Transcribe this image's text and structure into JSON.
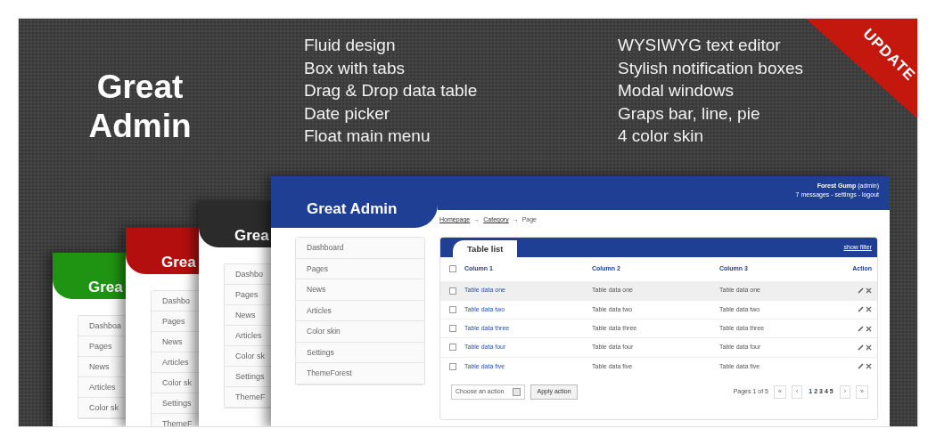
{
  "banner": {
    "title": "Great Admin",
    "ribbon": "UPDATE",
    "features_left": [
      "Fluid design",
      "Box with tabs",
      "Drag & Drop data table",
      "Date picker",
      "Float main menu"
    ],
    "features_right": [
      "WYSIWYG text editor",
      "Stylish notification boxes",
      "Modal windows",
      "Graps bar, line, pie",
      "4 color skin"
    ]
  },
  "skin_previews": [
    {
      "color": "#1f9412",
      "logo": "Grea",
      "menu": [
        "Dashboa",
        "Pages",
        "News",
        "Articles",
        "Color sk"
      ]
    },
    {
      "color": "#b30f0f",
      "logo": "Grea",
      "menu": [
        "Dashbo",
        "Pages",
        "News",
        "Articles",
        "Color sk",
        "Settings",
        "ThemeF"
      ]
    },
    {
      "color": "#2b2b2b",
      "logo": "Grea",
      "menu": [
        "Dashbo",
        "Pages",
        "News",
        "Articles",
        "Color sk",
        "Settings",
        "ThemeF"
      ]
    }
  ],
  "admin_preview": {
    "color": "#1f3f94",
    "logo": "Great Admin",
    "user": "**Forest Gump** (admin)",
    "user_links": "7 messages - settings - logout",
    "breadcrumb_separator": "→",
    "breadcrumb": [
      {
        "label": "Homepage",
        "link": true
      },
      {
        "label": "Category",
        "link": true
      },
      {
        "label": "Page",
        "link": false
      }
    ],
    "menu": [
      "Dashboard",
      "Pages",
      "News",
      "Articles",
      "Color skin",
      "Settings",
      "ThemeForest"
    ],
    "panel": {
      "title": "Table list",
      "filter_link": "show filter",
      "table": {
        "columns": [
          "Column 1",
          "Column 2",
          "Column 3",
          "Action"
        ],
        "header_checked": false,
        "rows": [
          {
            "cells": [
              "Table data one",
              "Table data one",
              "Table data one"
            ],
            "checked": false,
            "highlighted": true
          },
          {
            "cells": [
              "Table data two",
              "Table data two",
              "Table data two"
            ],
            "checked": false,
            "highlighted": false
          },
          {
            "cells": [
              "Table data three",
              "Table data three",
              "Table data three"
            ],
            "checked": false,
            "highlighted": false
          },
          {
            "cells": [
              "Table data four",
              "Table data four",
              "Table data four"
            ],
            "checked": false,
            "highlighted": false
          },
          {
            "cells": [
              "Table data five",
              "Table data five",
              "Table data five"
            ],
            "checked": false,
            "highlighted": false
          }
        ]
      },
      "action_select": "Choose an action",
      "apply_button": "Apply action",
      "page_info": "Pages 1 of 5",
      "pager_first": "«",
      "pager_prev": "‹",
      "pager_next": "›",
      "pager_last": "»",
      "pages": [
        {
          "label": "1",
          "selected": true
        },
        {
          "label": "2",
          "selected": false
        },
        {
          "label": "3",
          "selected": false
        },
        {
          "label": "4",
          "selected": false
        },
        {
          "label": "5",
          "selected": false
        }
      ]
    }
  }
}
